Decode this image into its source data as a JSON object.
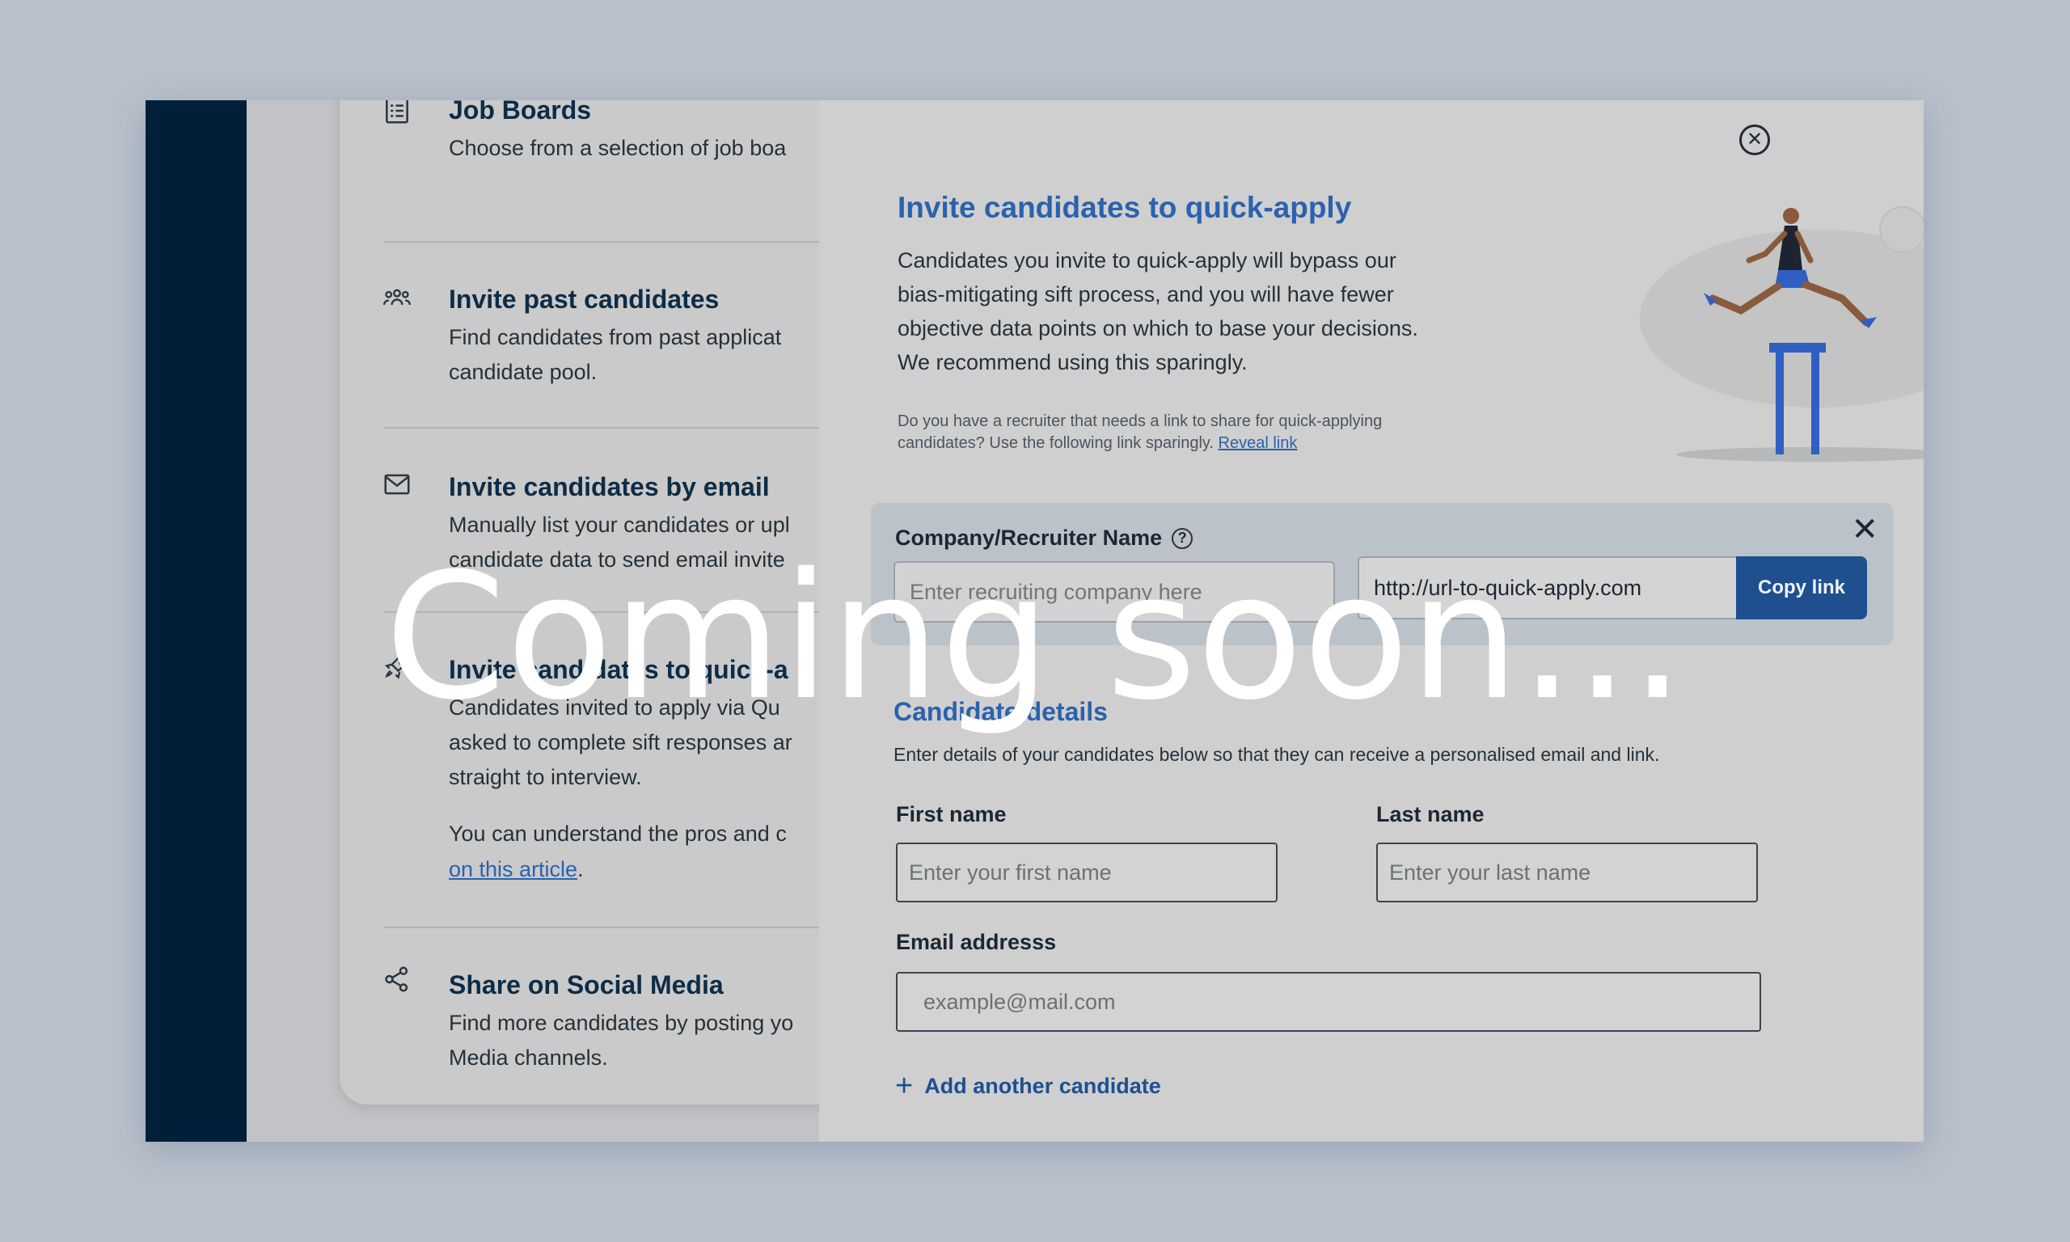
{
  "left_panel": {
    "options": [
      {
        "title": "Job Boards",
        "desc": [
          "Choose from a selection of job boa"
        ],
        "icon": "list-icon"
      },
      {
        "title": "Invite past candidates",
        "desc": [
          "Find candidates from past applicat",
          "candidate pool."
        ],
        "icon": "people-icon"
      },
      {
        "title": "Invite candidates by email",
        "desc": [
          "Manually list your candidates or upl",
          "candidate data to send email invite"
        ],
        "icon": "envelope-icon"
      },
      {
        "title": "Invite candidates to quick-a",
        "desc": [
          "Candidates invited to apply via Qu",
          "asked to complete sift responses ar",
          "straight to interview."
        ],
        "extra_text": "You can understand the pros and c",
        "extra_link": "on this article",
        "icon": "rocket-icon"
      },
      {
        "title": "Share on Social Media",
        "desc": [
          "Find more candidates by posting yo",
          "Media channels."
        ],
        "icon": "share-icon"
      }
    ]
  },
  "modal": {
    "close_icon": "close-circle-icon",
    "close_symbol": "✕",
    "title": "Invite candidates to quick-apply",
    "description": "Candidates you invite to quick-apply will bypass our bias-mitigating sift process, and you will have fewer objective data points on which to base your decisions. We recommend using this sparingly.",
    "note": "Do you have a recruiter that needs a link to share for quick-applying candidates? Use the following link sparingly.",
    "reveal_link": "Reveal link",
    "recruiter": {
      "label": "Company/Recruiter Name",
      "help_symbol": "?",
      "close_symbol": "✕",
      "company_placeholder": "Enter recruiting company here",
      "url": "http://url-to-quick-apply.com",
      "copy_label": "Copy link"
    },
    "candidate": {
      "title": "Candidate details",
      "description": "Enter details of your candidates below so that they can receive a personalised email and link.",
      "first_label": "First name",
      "first_placeholder": "Enter your first name",
      "last_label": "Last name",
      "last_placeholder": "Enter your last name",
      "email_label": "Email addresss",
      "email_placeholder": "example@mail.com",
      "add_symbol": "+",
      "add_label": "Add another candidate"
    }
  },
  "overlay": {
    "text": "Coming soon..."
  },
  "colors": {
    "accent": "#2a62ad",
    "button": "#1f4f8f",
    "navbar": "#00203a"
  }
}
